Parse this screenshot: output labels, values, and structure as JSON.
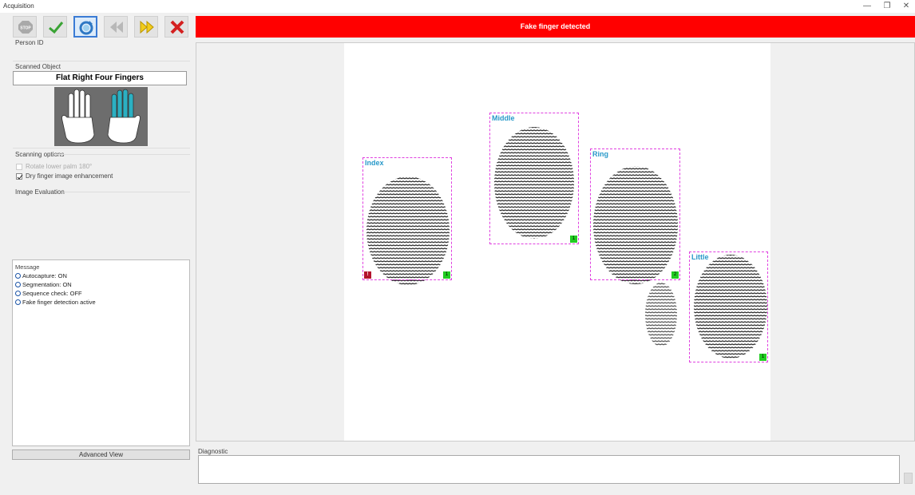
{
  "window": {
    "title": "Acquisition",
    "minimize": "—",
    "restore": "❐",
    "close": "✕"
  },
  "toolbar": {
    "stop_label": "STOP",
    "buttons": [
      {
        "name": "stop-button",
        "icon": "stop-icon"
      },
      {
        "name": "accept-button",
        "icon": "checkmark-icon"
      },
      {
        "name": "refresh-button",
        "icon": "refresh-icon",
        "active": true
      },
      {
        "name": "previous-button",
        "icon": "rewind-icon"
      },
      {
        "name": "next-button",
        "icon": "fast-forward-icon"
      },
      {
        "name": "cancel-button",
        "icon": "close-icon"
      }
    ]
  },
  "left_panel": {
    "person_id_label": "Person ID",
    "scanned_object_label": "Scanned Object",
    "scanned_object_value": "Flat Right Four Fingers",
    "scanning_options_label": "Scanning options",
    "option_rotate": "Rotate lower palm 180°",
    "option_rotate_checked": false,
    "option_dry": "Dry finger image enhancement",
    "option_dry_checked": true,
    "image_evaluation_label": "Image Evaluation",
    "message_label": "Message",
    "messages": [
      "Autocapture: ON",
      "Segmentation: ON",
      "Sequence check: OFF",
      "Fake finger detection active"
    ],
    "advanced_view_label": "Advanced View"
  },
  "status_banner": {
    "text": "Fake finger detected",
    "color": "#ff0000"
  },
  "fingers": [
    {
      "name": "Index",
      "quality": "1",
      "warning": "!"
    },
    {
      "name": "Middle",
      "quality": "1"
    },
    {
      "name": "Ring",
      "quality": "2"
    },
    {
      "name": "Little",
      "quality": "1"
    }
  ],
  "diagnostic": {
    "label": "Diagnostic"
  },
  "colors": {
    "accent": "#3a7bd5",
    "segment_border": "#e040e0",
    "finger_label": "#2899c9",
    "good_quality": "#22cc22",
    "warning": "#b3122e"
  }
}
